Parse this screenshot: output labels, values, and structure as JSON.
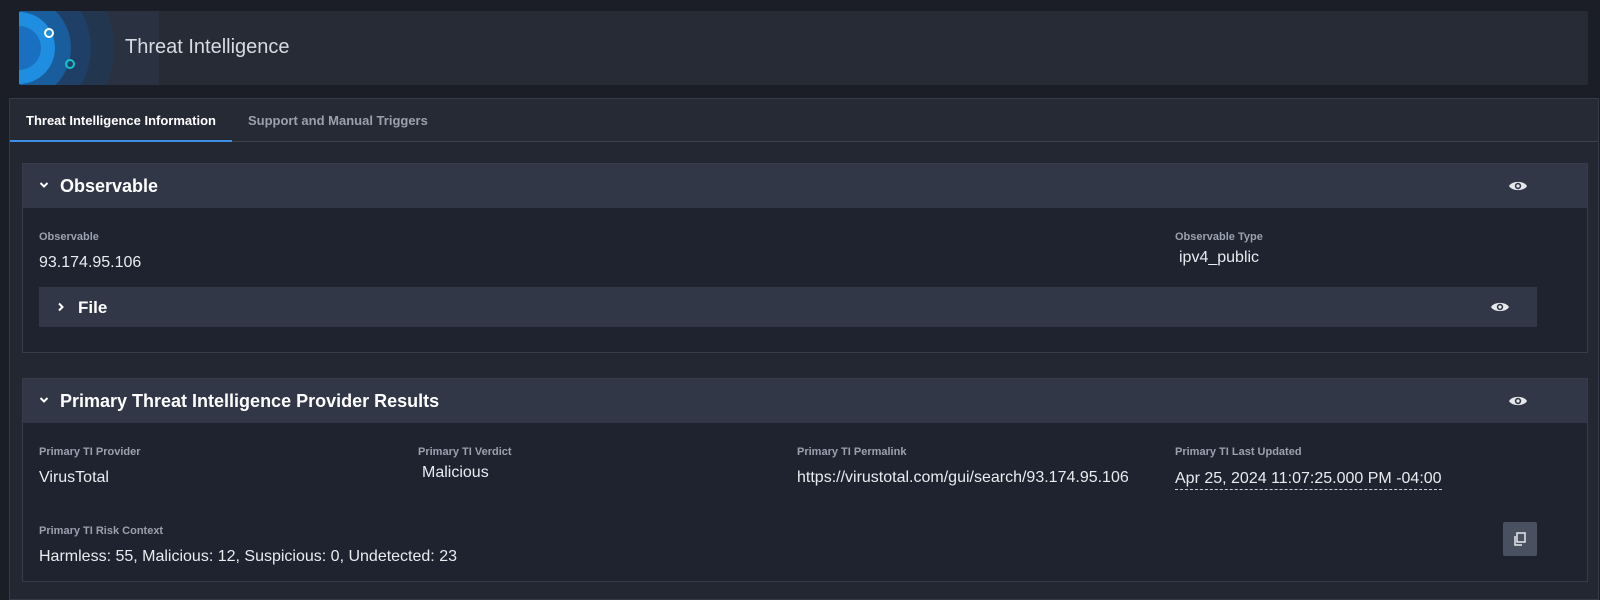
{
  "header": {
    "title": "Threat Intelligence"
  },
  "tabs": [
    {
      "label": "Threat Intelligence Information"
    },
    {
      "label": "Support and Manual Triggers"
    }
  ],
  "observable_section": {
    "title": "Observable",
    "fields": {
      "observable": {
        "label": "Observable",
        "value": "93.174.95.106"
      },
      "observable_type": {
        "label": "Observable Type",
        "value": "ipv4_public"
      }
    },
    "file_subsection": {
      "title": "File"
    }
  },
  "primary_section": {
    "title": "Primary Threat Intelligence Provider Results",
    "fields": {
      "provider": {
        "label": "Primary TI Provider",
        "value": "VirusTotal"
      },
      "verdict": {
        "label": "Primary TI Verdict",
        "value": "Malicious"
      },
      "permalink": {
        "label": "Primary TI Permalink",
        "value": "https://virustotal.com/gui/search/93.174.95.106"
      },
      "last_updated": {
        "label": "Primary TI Last Updated",
        "value": "Apr 25, 2024 11:07:25.000 PM -04:00"
      },
      "risk_context": {
        "label": "Primary TI Risk Context",
        "value": "Harmless: 55, Malicious: 12, Suspicious: 0, Undetected: 23"
      }
    }
  },
  "icons": {
    "collapse": "chevron-down-icon",
    "expand": "chevron-right-icon",
    "visibility": "eye-icon",
    "copy": "copy-icon"
  },
  "colors": {
    "accent_tab": "#3d8fe6",
    "logo_blue": "#1f8de0",
    "logo_teal": "#19c2c7"
  }
}
